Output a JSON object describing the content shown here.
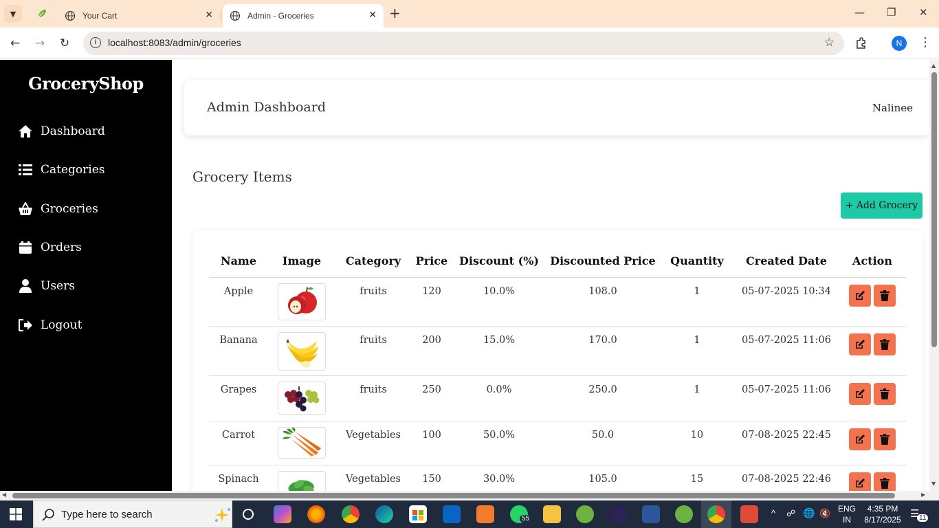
{
  "browser": {
    "tabs": [
      {
        "title": "Your Cart",
        "active": false
      },
      {
        "title": "Admin - Groceries",
        "active": true
      }
    ],
    "url": "localhost:8083/admin/groceries",
    "profile_initial": "N"
  },
  "sidebar": {
    "brand": "GroceryShop",
    "items": [
      {
        "label": "Dashboard",
        "icon": "home-icon"
      },
      {
        "label": "Categories",
        "icon": "list-icon"
      },
      {
        "label": "Groceries",
        "icon": "basket-icon"
      },
      {
        "label": "Orders",
        "icon": "orders-icon"
      },
      {
        "label": "Users",
        "icon": "user-icon"
      },
      {
        "label": "Logout",
        "icon": "logout-icon"
      }
    ]
  },
  "header": {
    "title": "Admin Dashboard",
    "user": "Nalinee"
  },
  "main": {
    "section_title": "Grocery Items",
    "add_button": "+ Add Grocery"
  },
  "table": {
    "columns": [
      "Name",
      "Image",
      "Category",
      "Price",
      "Discount (%)",
      "Discounted Price",
      "Quantity",
      "Created Date",
      "Action"
    ],
    "rows": [
      {
        "name": "Apple",
        "image": "apple-image",
        "category": "fruits",
        "price": "120",
        "discount": "10.0%",
        "discounted_price": "108.0",
        "quantity": "1",
        "created": "05-07-2025 10:34"
      },
      {
        "name": "Banana",
        "image": "banana-image",
        "category": "fruits",
        "price": "200",
        "discount": "15.0%",
        "discounted_price": "170.0",
        "quantity": "1",
        "created": "05-07-2025 11:06"
      },
      {
        "name": "Grapes",
        "image": "grapes-image",
        "category": "fruits",
        "price": "250",
        "discount": "0.0%",
        "discounted_price": "250.0",
        "quantity": "1",
        "created": "05-07-2025 11:06"
      },
      {
        "name": "Carrot",
        "image": "carrot-image",
        "category": "Vegetables",
        "price": "100",
        "discount": "50.0%",
        "discounted_price": "50.0",
        "quantity": "10",
        "created": "07-08-2025 22:45"
      },
      {
        "name": "Spinach",
        "image": "spinach-image",
        "category": "Vegetables",
        "price": "150",
        "discount": "30.0%",
        "discounted_price": "105.0",
        "quantity": "15",
        "created": "07-08-2025 22:46"
      }
    ]
  },
  "taskbar": {
    "search_placeholder": "Type here to search",
    "whatsapp_badge": "55",
    "lang_top": "ENG",
    "lang_bottom": "IN",
    "time": "4:35 PM",
    "date": "8/17/2025",
    "notifications": "11"
  },
  "colors": {
    "accent_add": "#1ec9a8",
    "action_buttons": "#f5724f",
    "sidebar_bg": "#000000",
    "tabbar_bg": "#fde6cf"
  }
}
